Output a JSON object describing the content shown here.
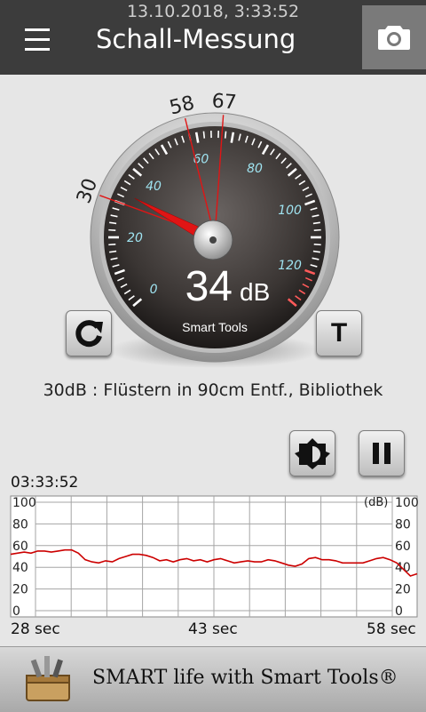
{
  "status": {
    "datetime": "13.10.2018, 3:33:52"
  },
  "header": {
    "title": "Schall-Messung",
    "menu_icon": "hamburger-icon",
    "camera_icon": "camera-icon"
  },
  "gauge": {
    "value": 34,
    "value_text": "34",
    "unit": "dB",
    "brand": "Smart Tools",
    "min_marker": 30,
    "avg_marker": 58,
    "max_marker": 67,
    "min_marker_label": "30",
    "avg_marker_label": "58",
    "max_marker_label": "67",
    "scale_labels": [
      "0",
      "20",
      "40",
      "60",
      "80",
      "100",
      "120"
    ]
  },
  "controls": {
    "reset_icon": "refresh-icon",
    "t_button_label": "T",
    "brightness_icon": "brightness-icon",
    "pause_icon": "pause-icon"
  },
  "reading": {
    "text": "30dB : Flüstern in 90cm Entf., Bibliothek"
  },
  "history": {
    "time": "03:33:52",
    "unit_label": "(dB)",
    "x_labels": [
      "28 sec",
      "43 sec",
      "58 sec"
    ]
  },
  "chart_data": {
    "type": "line",
    "title": "",
    "xlabel": "",
    "ylabel": "(dB)",
    "x_range": [
      28,
      58
    ],
    "ylim": [
      0,
      100
    ],
    "y_ticks": [
      0,
      20,
      40,
      60,
      80,
      100
    ],
    "grid": true,
    "series": [
      {
        "color": "#cc0000",
        "x": [
          28,
          28.5,
          29,
          29.5,
          30,
          30.5,
          31,
          31.5,
          32,
          32.5,
          33,
          33.5,
          34,
          34.5,
          35,
          35.5,
          36,
          36.5,
          37,
          37.5,
          38,
          38.5,
          39,
          39.5,
          40,
          40.5,
          41,
          41.5,
          42,
          42.5,
          43,
          43.5,
          44,
          44.5,
          45,
          45.5,
          46,
          46.5,
          47,
          47.5,
          48,
          48.5,
          49,
          49.5,
          50,
          50.5,
          51,
          51.5,
          52,
          52.5,
          53,
          53.5,
          54,
          54.5,
          55,
          55.5,
          56,
          56.5,
          57,
          57.5,
          58
        ],
        "values": [
          52,
          53,
          54,
          53,
          55,
          55,
          54,
          55,
          56,
          56,
          53,
          47,
          45,
          44,
          46,
          45,
          48,
          50,
          52,
          52,
          51,
          49,
          46,
          47,
          45,
          47,
          48,
          46,
          47,
          45,
          47,
          48,
          46,
          44,
          45,
          46,
          45,
          45,
          47,
          46,
          44,
          42,
          41,
          43,
          48,
          49,
          47,
          47,
          46,
          44,
          44,
          44,
          44,
          46,
          48,
          49,
          47,
          44,
          38,
          32,
          34
        ]
      }
    ]
  },
  "banner": {
    "text": "SMART life with Smart Tools®",
    "logo_icon": "toolbox-icon"
  }
}
